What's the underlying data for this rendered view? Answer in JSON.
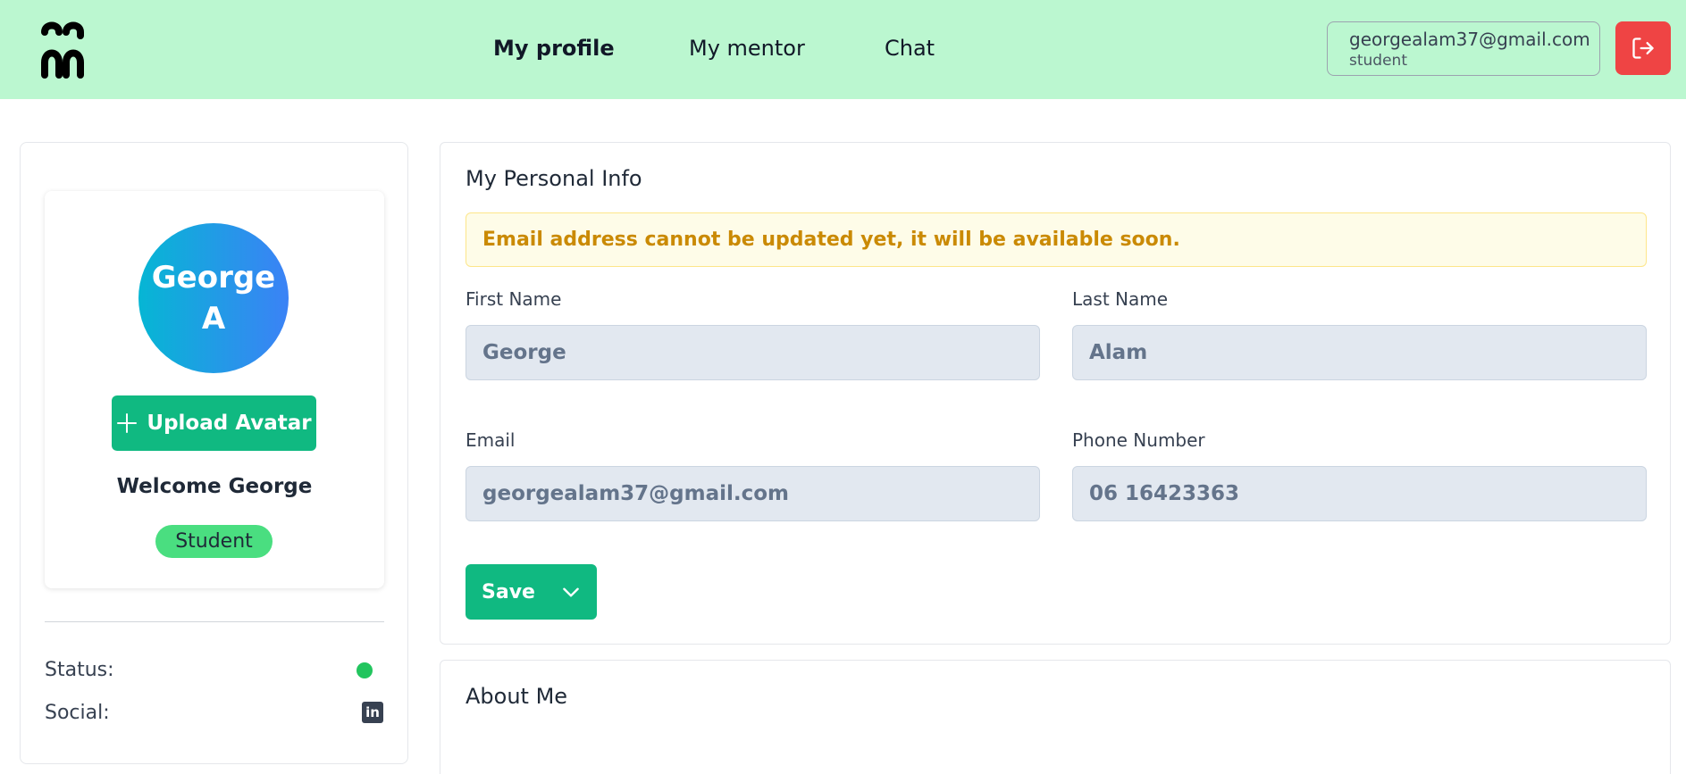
{
  "header": {
    "nav": [
      {
        "label": "My profile",
        "active": true
      },
      {
        "label": "My mentor",
        "active": false
      },
      {
        "label": "Chat",
        "active": false
      }
    ],
    "user": {
      "email": "georgealam37@gmail.com",
      "role": "student"
    },
    "logout_icon": "logout-icon"
  },
  "profile": {
    "avatar_line1": "George",
    "avatar_line2": "A",
    "upload_label": "Upload Avatar",
    "welcome": "Welcome George",
    "role_badge": "Student",
    "status_label": "Status:",
    "social_label": "Social:",
    "status_color": "#22c55e"
  },
  "personal_info": {
    "title": "My Personal Info",
    "alert": "Email address cannot be updated yet, it will be available soon.",
    "first_name_label": "First Name",
    "first_name_value": "George",
    "last_name_label": "Last Name",
    "last_name_value": "Alam",
    "email_label": "Email",
    "email_value": "georgealam37@gmail.com",
    "phone_label": "Phone Number",
    "phone_value": "06 16423363",
    "save_label": "Save"
  },
  "about": {
    "title": "About Me"
  },
  "colors": {
    "header_bg": "#bbf7d0",
    "primary": "#10b981",
    "danger": "#ef4444",
    "warning": "#ca8a04"
  }
}
